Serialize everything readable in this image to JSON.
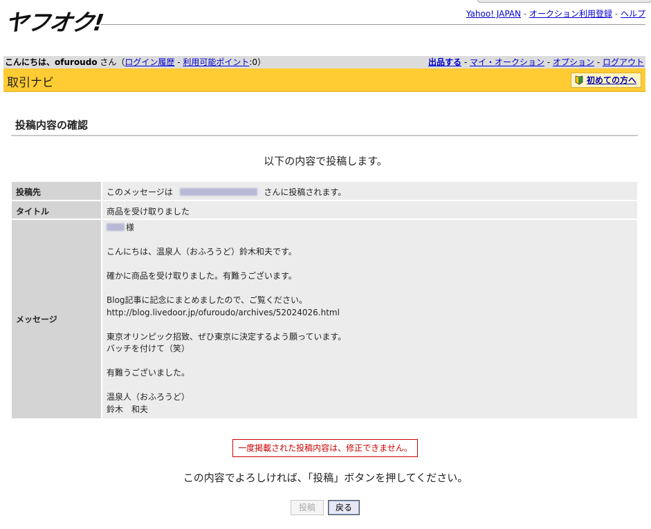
{
  "header": {
    "logo": "ヤフオク!",
    "links": [
      "Yahoo! JAPAN",
      "オークション利用登録",
      "ヘルプ"
    ]
  },
  "user_bar": {
    "greeting": "こんにちは、",
    "username": "ofuroudo",
    "san": " さん（",
    "login_history": "ログイン履歴",
    "sep": " - ",
    "points_label": "利用可能ポイント",
    "points_value": ":0）",
    "right_links": [
      "出品する",
      "マイ・オークション",
      "オプション",
      "ログアウト"
    ]
  },
  "navi": {
    "title": "取引ナビ",
    "beginner": "初めての方へ"
  },
  "page": {
    "section_title": "投稿内容の確認",
    "lead": "以下の内容で投稿します。",
    "warning": "一度掲載された投稿内容は、修正できません。",
    "confirm": "この内容でよろしければ、「投稿」ボタンを押してください。",
    "post_button": "投稿",
    "back_button": "戻る"
  },
  "table": {
    "dest_label": "投稿先",
    "dest_prefix": "このメッセージは",
    "dest_suffix": "さんに投稿されます。",
    "title_label": "タイトル",
    "title_value": "商品を受け取りました",
    "message_label": "メッセージ",
    "message_lines": [
      "様",
      "",
      "こんにちは、温泉人（おふろうど）鈴木和夫です。",
      "",
      "確かに商品を受け取りました。有難うございます。",
      "",
      "Blog記事に記念にまとめましたので、ご覧ください。",
      "http://blog.livedoor.jp/ofuroudo/archives/52024026.html",
      "",
      "東京オリンピック招致、ぜひ東京に決定するよう願っています。",
      "バッチを付けて（笑）",
      "",
      "有難うございました。",
      "",
      "温泉人（おふろうど）",
      "鈴木　和夫"
    ]
  }
}
